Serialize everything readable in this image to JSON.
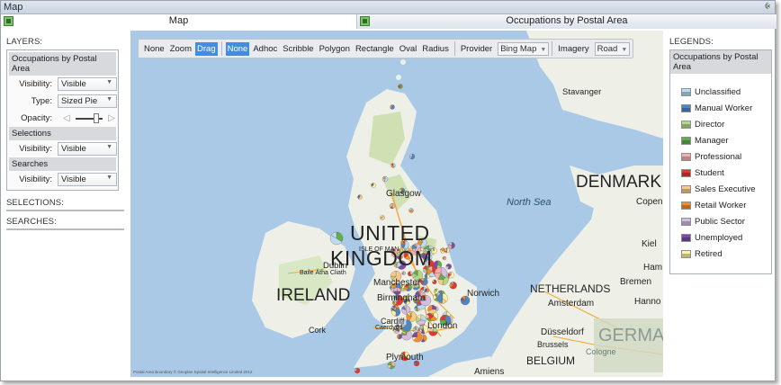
{
  "window": {
    "title": "Map",
    "pin_glyph": "⨴"
  },
  "tabs": [
    {
      "label": "Map",
      "icon": "spreadsheet-icon"
    },
    {
      "label": "Occupations by Postal Area",
      "icon": "spreadsheet-icon"
    }
  ],
  "left_panel": {
    "layers_title": "LAYERS:",
    "layer_name": "Occupations by Postal Area",
    "visibility_label": "Visibility:",
    "visibility_value": "Visible",
    "type_label": "Type:",
    "type_value": "Sized Pie",
    "opacity_label": "Opacity:",
    "opacity_level": 0.75,
    "selections_band": "Selections",
    "selections_visibility_label": "Visibility:",
    "selections_visibility_value": "Visible",
    "searches_band": "Searches",
    "searches_visibility_label": "Visibility:",
    "searches_visibility_value": "Visible",
    "selections_title": "SELECTIONS:",
    "searches_title": "SEARCHES:"
  },
  "toolbar": {
    "nav": [
      {
        "label": "None",
        "active": false
      },
      {
        "label": "Zoom",
        "active": false
      },
      {
        "label": "Drag",
        "active": true
      }
    ],
    "select": [
      {
        "label": "None",
        "active": true
      },
      {
        "label": "Adhoc",
        "active": false
      },
      {
        "label": "Scribble",
        "active": false
      },
      {
        "label": "Polygon",
        "active": false
      },
      {
        "label": "Rectangle",
        "active": false
      },
      {
        "label": "Oval",
        "active": false
      },
      {
        "label": "Radius",
        "active": false
      }
    ],
    "provider_label": "Provider",
    "provider_value": "Bing Map",
    "imagery_label": "Imagery",
    "imagery_value": "Road"
  },
  "map": {
    "labels": {
      "uk_line1": "UNITED",
      "uk_line2": "KINGDOM",
      "ireland": "IRELAND",
      "denmark": "DENMARK",
      "netherlands": "NETHERLANDS",
      "belgium": "BELGIUM",
      "germany": "GERMA",
      "north_sea": "North Sea",
      "glasgow": "Glasgow",
      "manchester": "Manchester",
      "birmingham": "Birmingham",
      "cardiff": "Cardiff",
      "caerdydd": "Caerdydd",
      "london": "London",
      "norwich": "Norwich",
      "dublin": "Dublin",
      "baile_atha_cliath": "Baile Átha Cliath",
      "cork": "Cork",
      "isle_of_man": "ISLE OF MAN",
      "plymouth": "Plymouth",
      "stavanger": "Stavanger",
      "amsterdam": "Amsterdam",
      "dusseldorf": "Düsseldorf",
      "brussels": "Brussels",
      "cologne": "Cologne",
      "amiens": "Amiens",
      "bremen": "Bremen",
      "hannover": "Hanno",
      "kiel": "Kiel",
      "ham": "Ham",
      "copenhagen": "Copen"
    },
    "attribution": "Postal Area Boundary © Geoplan Spatial Intelligence Limited 2012"
  },
  "legend": {
    "title": "LEGENDS:",
    "layer_name": "Occupations by Postal Area",
    "items": [
      {
        "label": "Unclassified",
        "color": "#b9dcf2"
      },
      {
        "label": "Manual Worker",
        "color": "#4d86c6"
      },
      {
        "label": "Director",
        "color": "#b4d88a"
      },
      {
        "label": "Manager",
        "color": "#5fae4f"
      },
      {
        "label": "Professional",
        "color": "#f7b0b0"
      },
      {
        "label": "Student",
        "color": "#e8342c"
      },
      {
        "label": "Sales Executive",
        "color": "#fbc98a"
      },
      {
        "label": "Retail Worker",
        "color": "#f38d2b"
      },
      {
        "label": "Public Sector",
        "color": "#d3bde0"
      },
      {
        "label": "Unemployed",
        "color": "#7b4aa8"
      },
      {
        "label": "Retired",
        "color": "#fdf2a6"
      }
    ]
  }
}
